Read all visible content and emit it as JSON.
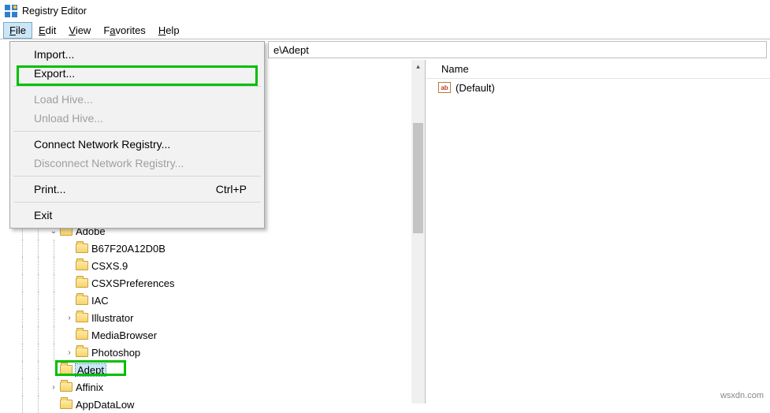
{
  "window": {
    "title": "Registry Editor"
  },
  "menu": {
    "items": [
      {
        "label": "File",
        "hot": "F",
        "active": true
      },
      {
        "label": "Edit",
        "hot": "E",
        "active": false
      },
      {
        "label": "View",
        "hot": "V",
        "active": false
      },
      {
        "label": "Favorites",
        "hot": "a",
        "active": false
      },
      {
        "label": "Help",
        "hot": "H",
        "active": false
      }
    ]
  },
  "address": {
    "visible_suffix": "e\\Adept"
  },
  "file_menu": {
    "items": [
      {
        "label": "Import...",
        "enabled": true,
        "shortcut": ""
      },
      {
        "label": "Export...",
        "enabled": true,
        "shortcut": "",
        "highlight": true
      },
      {
        "separator": true
      },
      {
        "label": "Load Hive...",
        "enabled": false,
        "shortcut": ""
      },
      {
        "label": "Unload Hive...",
        "enabled": false,
        "shortcut": ""
      },
      {
        "separator": true
      },
      {
        "label": "Connect Network Registry...",
        "enabled": true,
        "shortcut": ""
      },
      {
        "label": "Disconnect Network Registry...",
        "enabled": false,
        "shortcut": ""
      },
      {
        "separator": true
      },
      {
        "label": "Print...",
        "enabled": true,
        "shortcut": "Ctrl+P"
      },
      {
        "separator": true
      },
      {
        "label": "Exit",
        "enabled": true,
        "shortcut": ""
      }
    ]
  },
  "tree": {
    "visible_nodes": [
      {
        "indent": 3,
        "expander": "open",
        "label": "Adobe"
      },
      {
        "indent": 4,
        "expander": "none",
        "label": "B67F20A12D0B"
      },
      {
        "indent": 4,
        "expander": "none",
        "label": "CSXS.9"
      },
      {
        "indent": 4,
        "expander": "none",
        "label": "CSXSPreferences"
      },
      {
        "indent": 4,
        "expander": "none",
        "label": "IAC"
      },
      {
        "indent": 4,
        "expander": "closed",
        "label": "Illustrator"
      },
      {
        "indent": 4,
        "expander": "none",
        "label": "MediaBrowser"
      },
      {
        "indent": 4,
        "expander": "closed",
        "label": "Photoshop"
      },
      {
        "indent": 3,
        "expander": "none",
        "label": "Adept",
        "selected": true,
        "green": true
      },
      {
        "indent": 3,
        "expander": "closed",
        "label": "Affinix"
      },
      {
        "indent": 3,
        "expander": "none",
        "label": "AppDataLow"
      }
    ]
  },
  "right_pane": {
    "header": "Name",
    "rows": [
      {
        "icon": "ab",
        "name": "(Default)"
      }
    ]
  },
  "watermark": "wsxdn.com"
}
